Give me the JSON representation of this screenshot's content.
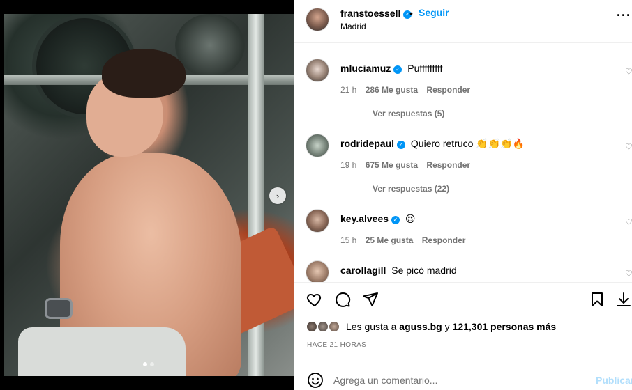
{
  "post": {
    "owner": "franstoessell",
    "separator": "•",
    "follow_label": "Seguir",
    "location": "Madrid",
    "more_label": "···"
  },
  "media": {
    "next_label": "›",
    "slide_count": 2,
    "active_slide": 1
  },
  "comments": [
    {
      "user": "mluciamuz",
      "text": "Pufffffffff",
      "time": "21 h",
      "likes": "286 Me gusta",
      "reply": "Responder",
      "view_replies": "Ver respuestas (5)"
    },
    {
      "user": "rodridepaul",
      "text": "Quiero retruco 👏👏👏🔥",
      "time": "19 h",
      "likes": "675 Me gusta",
      "reply": "Responder",
      "view_replies": "Ver respuestas (22)"
    },
    {
      "user": "key.alvees",
      "text": "😍",
      "time": "15 h",
      "likes": "25 Me gusta",
      "reply": "Responder"
    },
    {
      "user": "carollagill",
      "text": "Se picó madrid"
    }
  ],
  "likes": {
    "prefix": "Les gusta a",
    "user": "aguss.bg",
    "middle": "y",
    "count": "121,301 personas más"
  },
  "timestamp": "HACE 21 HORAS",
  "comment_box": {
    "placeholder": "Agrega un comentario...",
    "publish_label": "Publicar"
  },
  "colors": {
    "accent": "#0095f6",
    "muted": "#737373",
    "publish_disabled": "#b2dffc"
  },
  "icons": [
    "heart-icon",
    "comment-icon",
    "share-icon",
    "bookmark-icon",
    "download-icon",
    "emoji-icon",
    "verified-badge-icon",
    "more-options-icon"
  ]
}
